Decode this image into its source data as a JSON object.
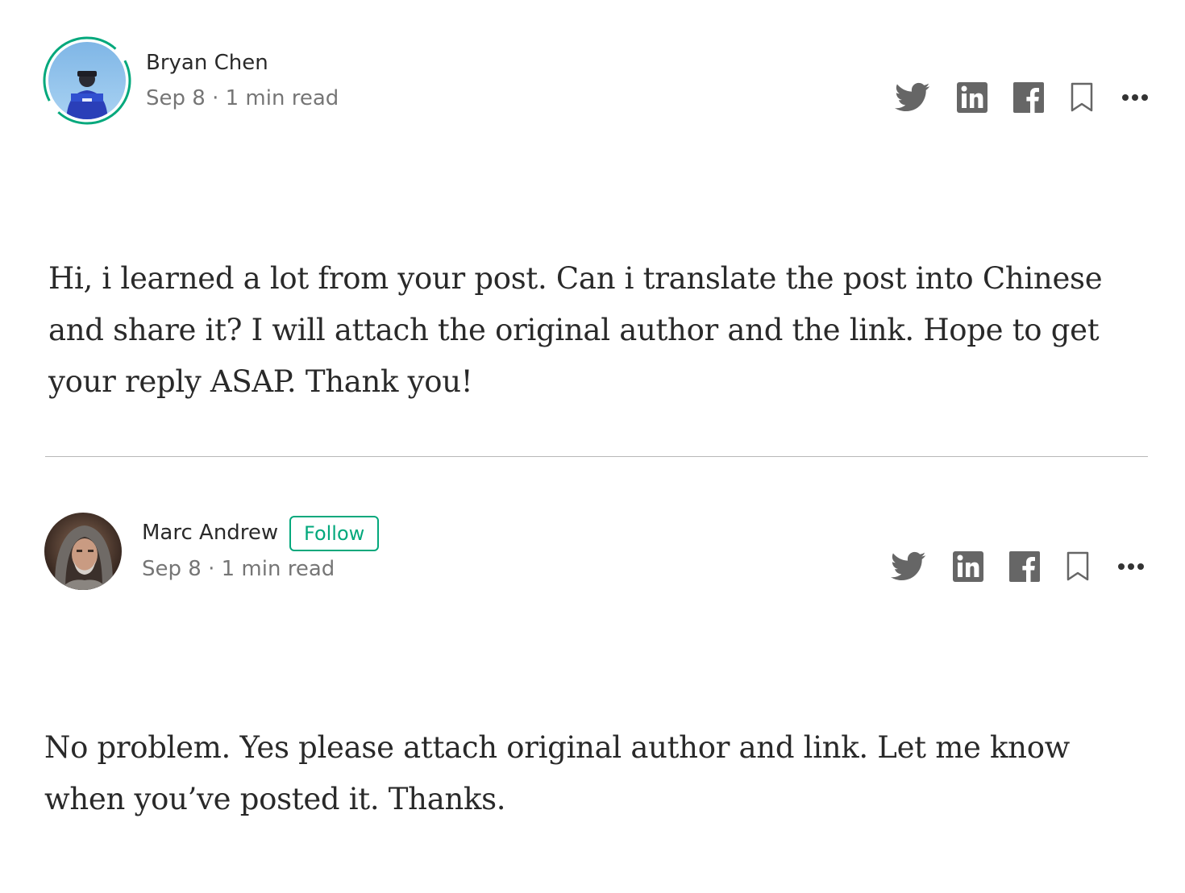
{
  "responses": [
    {
      "author": "Bryan Chen",
      "date": "Sep 8",
      "separator": "·",
      "read_time": "1 min read",
      "text": "Hi, i learned a lot from your post. Can i translate the post into Chinese and share it? I will attach the original author and the link. Hope to get your reply ASAP. Thank you!",
      "avatar_ring": true
    },
    {
      "author": "Marc Andrew",
      "follow_label": "Follow",
      "date": "Sep 8",
      "separator": "·",
      "read_time": "1 min read",
      "text": "No problem. Yes please attach original author and link. Let me know when you’ve posted it. Thanks.",
      "avatar_ring": false
    }
  ],
  "icons": {
    "twitter": "twitter-icon",
    "linkedin": "linkedin-icon",
    "facebook": "facebook-icon",
    "bookmark": "bookmark-icon",
    "more": "more-icon"
  },
  "colors": {
    "accent": "#03a87c",
    "icon": "#666666",
    "text": "#1f1f1f",
    "meta": "#757575"
  }
}
